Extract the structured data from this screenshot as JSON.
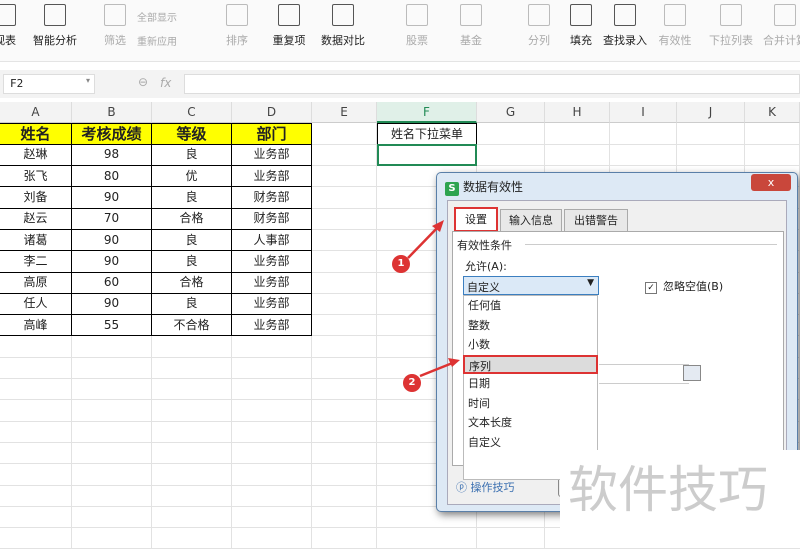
{
  "toolbar": {
    "items": [
      {
        "label": "视表",
        "enabled": true
      },
      {
        "label": "智能分析",
        "enabled": true
      },
      {
        "label": "筛选",
        "enabled": false
      },
      {
        "label": "排序",
        "enabled": false
      },
      {
        "label": "重复项",
        "enabled": true
      },
      {
        "label": "数据对比",
        "enabled": true
      },
      {
        "label": "股票",
        "enabled": false
      },
      {
        "label": "基金",
        "enabled": false
      },
      {
        "label": "分列",
        "enabled": false
      },
      {
        "label": "填充",
        "enabled": true
      },
      {
        "label": "查找录入",
        "enabled": true
      },
      {
        "label": "有效性",
        "enabled": false
      },
      {
        "label": "下拉列表",
        "enabled": false
      },
      {
        "label": "合并计算",
        "enabled": false
      }
    ],
    "show_all": "全部显示",
    "reapply": "重新应用"
  },
  "formula_bar": {
    "name_box": "F2",
    "fx": "fx",
    "value": ""
  },
  "columns": [
    "A",
    "B",
    "C",
    "D",
    "E",
    "F",
    "G",
    "H",
    "I",
    "J",
    "K"
  ],
  "table": {
    "headers": [
      "姓名",
      "考核成绩",
      "等级",
      "部门"
    ],
    "rows": [
      [
        "赵琳",
        "98",
        "良",
        "业务部"
      ],
      [
        "张飞",
        "80",
        "优",
        "业务部"
      ],
      [
        "刘备",
        "90",
        "良",
        "财务部"
      ],
      [
        "赵云",
        "70",
        "合格",
        "财务部"
      ],
      [
        "诸葛",
        "90",
        "良",
        "人事部"
      ],
      [
        "李二",
        "90",
        "良",
        "业务部"
      ],
      [
        "高原",
        "60",
        "合格",
        "业务部"
      ],
      [
        "任人",
        "90",
        "良",
        "业务部"
      ],
      [
        "高峰",
        "55",
        "不合格",
        "业务部"
      ]
    ]
  },
  "f1": "姓名下拉菜单",
  "dialog": {
    "title": "数据有效性",
    "logo": "S",
    "close": "x",
    "tabs": [
      "设置",
      "输入信息",
      "出错警告"
    ],
    "section": "有效性条件",
    "allow_label": "允许(A):",
    "allow_value": "自定义",
    "ignore_blank": "忽略空值(B)",
    "ignore_blank_checked": true,
    "options": [
      "任何值",
      "整数",
      "小数",
      "序列",
      "日期",
      "时间",
      "文本长度",
      "自定义"
    ],
    "highlighted": "序列",
    "tips": "操作技巧"
  },
  "annotations": [
    "1",
    "2"
  ],
  "watermark": "软件技巧"
}
